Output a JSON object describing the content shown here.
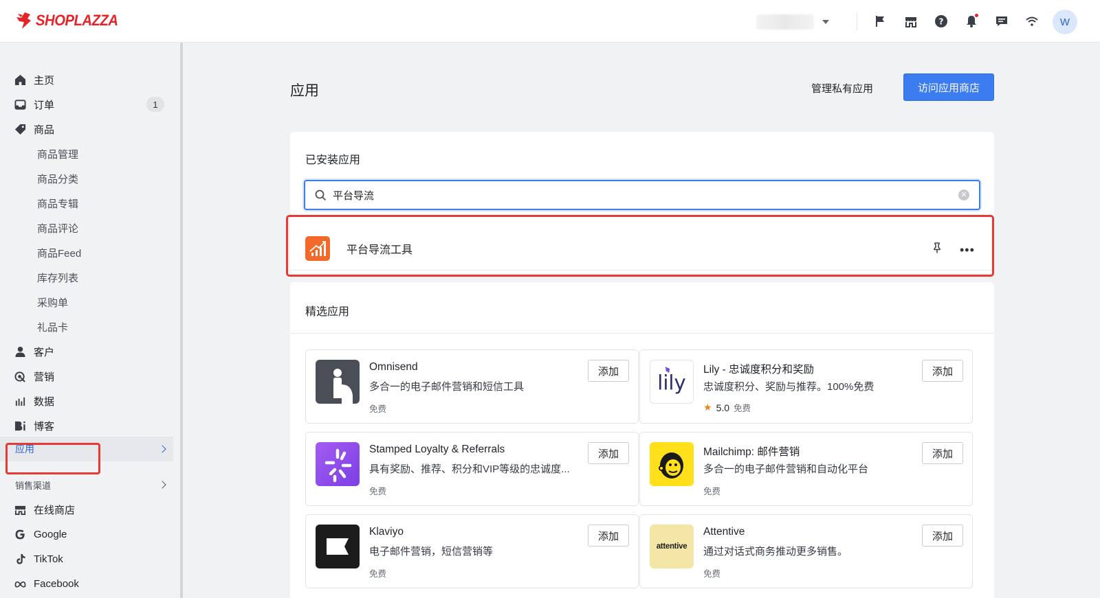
{
  "brand": {
    "name": "SHOPLAZZA",
    "color": "#e5242a"
  },
  "topbar": {
    "icons": [
      "flag-icon",
      "store-icon",
      "help-icon",
      "bell-icon",
      "message-icon",
      "wifi-icon"
    ],
    "avatar_initial": "W"
  },
  "sidebar": {
    "items": [
      {
        "label": "主页",
        "icon": "home-icon"
      },
      {
        "label": "订单",
        "icon": "inbox-icon",
        "badge": "1"
      },
      {
        "label": "商品",
        "icon": "tag-icon"
      }
    ],
    "product_sub": [
      "商品管理",
      "商品分类",
      "商品专辑",
      "商品评论",
      "商品Feed",
      "库存列表",
      "采购单",
      "礼品卡"
    ],
    "more_items": [
      {
        "label": "客户",
        "icon": "user-icon"
      },
      {
        "label": "营销",
        "icon": "marketing-icon"
      },
      {
        "label": "数据",
        "icon": "chart-icon"
      },
      {
        "label": "博客",
        "icon": "blog-icon"
      }
    ],
    "active_item": "应用",
    "sales_channels_label": "销售渠道",
    "channels": [
      {
        "label": "在线商店",
        "icon": "store-icon"
      },
      {
        "label": "Google",
        "icon": "google-icon"
      },
      {
        "label": "TikTok",
        "icon": "tiktok-icon"
      },
      {
        "label": "Facebook",
        "icon": "meta-icon"
      }
    ]
  },
  "main": {
    "title": "应用",
    "manage_private_label": "管理私有应用",
    "visit_store_label": "访问应用商店",
    "accent": "#3b7cf0",
    "installed": {
      "title": "已安装应用",
      "search_value": "平台导流",
      "app_name": "平台导流工具"
    },
    "featured": {
      "title": "精选应用",
      "add_label": "添加",
      "apps": [
        {
          "name": "Omnisend",
          "desc": "多合一的电子邮件营销和短信工具",
          "price": "免费"
        },
        {
          "name": "Lily - 忠诚度积分和奖励",
          "desc": "忠诚度积分、奖励与推荐。100%免费",
          "rating": "5.0",
          "price": "免费"
        },
        {
          "name": "Stamped Loyalty & Referrals",
          "desc": "具有奖励、推荐、积分和VIP等级的忠诚度...",
          "price": "免费"
        },
        {
          "name": "Mailchimp: 邮件营销",
          "desc": "多合一的电子邮件营销和自动化平台",
          "price": "免费"
        },
        {
          "name": "Klaviyo",
          "desc": "电子邮件营销，短信营销等",
          "price": "免费"
        },
        {
          "name": "Attentive",
          "desc": "通过对话式商务推动更多销售。",
          "price": "免费",
          "logo_text": "attentive"
        }
      ]
    }
  }
}
